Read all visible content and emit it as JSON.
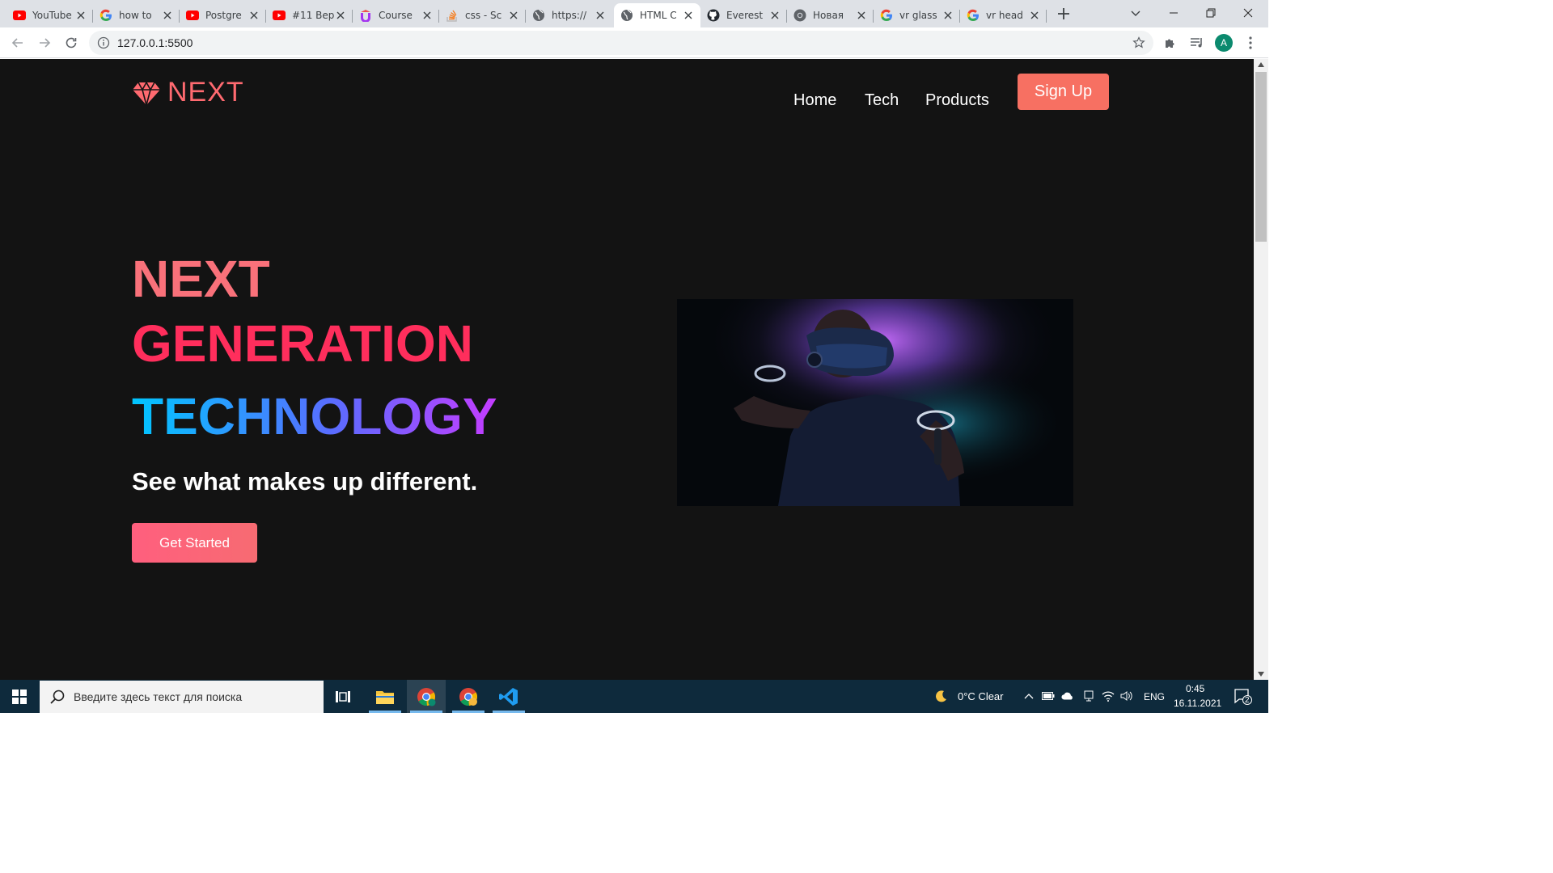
{
  "browser": {
    "tabs": [
      {
        "title": "YouTube",
        "favicon": "youtube-icon"
      },
      {
        "title": "how to",
        "favicon": "google-icon"
      },
      {
        "title": "Postgre",
        "favicon": "youtube-icon"
      },
      {
        "title": "#11 Вер",
        "favicon": "youtube-icon"
      },
      {
        "title": "Course",
        "favicon": "udemy-icon"
      },
      {
        "title": "css - Sc",
        "favicon": "stackoverflow-icon"
      },
      {
        "title": "https://",
        "favicon": "globe-icon"
      },
      {
        "title": "HTML C",
        "favicon": "globe-icon"
      },
      {
        "title": "Everest",
        "favicon": "github-icon"
      },
      {
        "title": "Новая",
        "favicon": "chrome-icon"
      },
      {
        "title": "vr glass",
        "favicon": "google-icon"
      },
      {
        "title": "vr head",
        "favicon": "google-icon"
      }
    ],
    "active_tab_index": 7,
    "url": "127.0.0.1:5500",
    "profile_initial": "A",
    "profile_color": "#0b8a6e"
  },
  "site": {
    "logo_text": "NEXT",
    "nav": [
      "Home",
      "Tech",
      "Products"
    ],
    "signup_label": "Sign Up",
    "heading": {
      "line1": "NEXT",
      "line2": "GENERATION",
      "line3": "TECHNOLOGY"
    },
    "tagline": "See what makes up different.",
    "cta_label": "Get Started",
    "hero_image": "vr-headset-person-image",
    "colors": {
      "background": "#131313",
      "accent": "#f77062",
      "heading_line1": "#f9717a",
      "heading_line2": "#ff2e5c",
      "heading_line3_gradient": [
        "#00c6ff",
        "#5a6cff",
        "#c53cff"
      ]
    }
  },
  "taskbar": {
    "search_placeholder": "Введите здесь текст для поиска",
    "weather": "0°C  Clear",
    "language": "ENG",
    "time": "0:45",
    "date": "16.11.2021",
    "notification_count": "2"
  }
}
